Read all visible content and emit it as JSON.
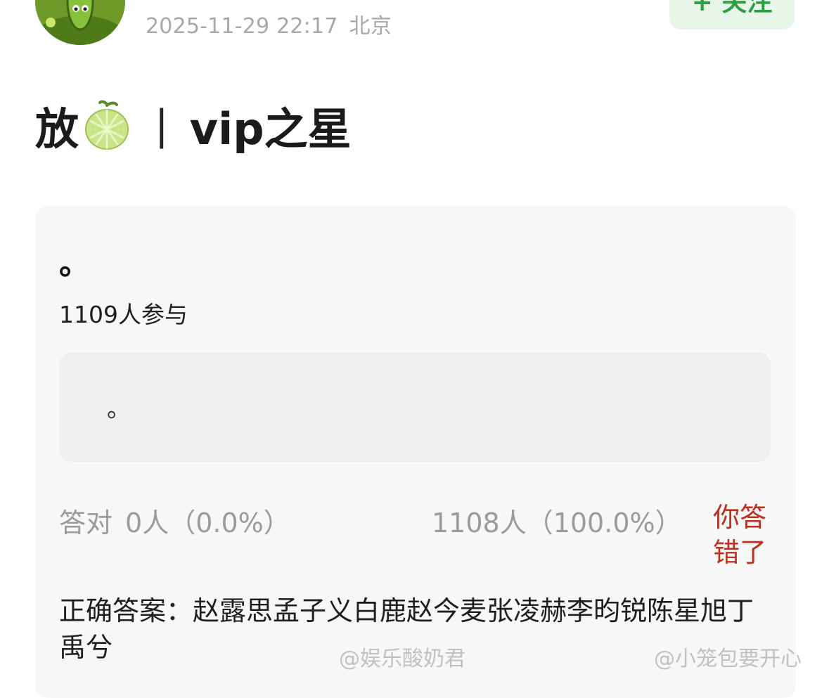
{
  "post": {
    "timestamp": "2025-11-29 22:17",
    "location": "北京",
    "follow_label": "+ 关注"
  },
  "title": {
    "prefix": "放",
    "emoji_icon": "melon-icon",
    "separator": "|",
    "text": "vip之星"
  },
  "quiz": {
    "question": "。",
    "participants": "1109人参与",
    "options": [
      {
        "text": "。"
      }
    ],
    "correct_label": "答对",
    "correct_count": "0人（0.0%）",
    "wrong_count": "1108人（100.0%）",
    "verdict": "你答错了",
    "correct_answer": "正确答案：赵露思孟子义白鹿赵今麦张凌赫李昀锐陈星旭丁禹兮"
  },
  "watermarks": [
    "@娱乐酸奶君",
    "@小笼包要开心"
  ],
  "colors": {
    "follow_bg": "#e7f6e8",
    "follow_text": "#2f9e44",
    "verdict": "#b8321f",
    "muted": "#9b9b9b",
    "card_bg": "#f7f7f7",
    "option_bg": "#efefef"
  }
}
